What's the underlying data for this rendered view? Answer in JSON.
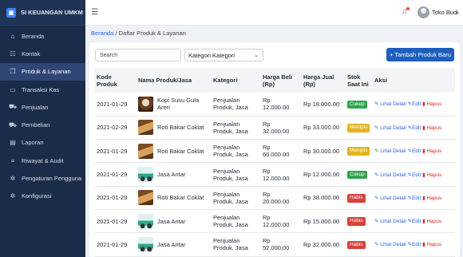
{
  "app": {
    "name": "SI KEUANGAN UMKM"
  },
  "sidebar": {
    "items": [
      {
        "label": "Beranda",
        "icon": "home-icon"
      },
      {
        "label": "Kontak",
        "icon": "users-icon"
      },
      {
        "label": "Produk & Layanan",
        "icon": "box-icon",
        "active": true
      },
      {
        "label": "Transaksi Kas",
        "icon": "cash-icon"
      },
      {
        "label": "Penjualan",
        "icon": "cart-icon"
      },
      {
        "label": "Pembelian",
        "icon": "truck-icon"
      },
      {
        "label": "Laporan",
        "icon": "chart-icon"
      },
      {
        "label": "Riwayat & Audit",
        "icon": "list-icon"
      },
      {
        "label": "Pengaturan Pengguna",
        "icon": "gear-icon"
      },
      {
        "label": "Konfigurasi",
        "icon": "gear-icon"
      }
    ]
  },
  "topbar": {
    "user": "Toko Budi"
  },
  "breadcrumb": {
    "home": "Beranda",
    "separator": "/",
    "current": "Daftar Produk & Layanan"
  },
  "toolbar": {
    "search_placeholder": "Search",
    "category_select": "Kategori Kategori",
    "add_button": "+ Tambah Produk Baru"
  },
  "table": {
    "headers": [
      "Kode Produk",
      "Nama Produk/Jasa",
      "Kategori",
      "Harga Beli (Rp)",
      "Harga Jual (Rp)",
      "Stok Saat Ini",
      "Aksi"
    ],
    "actions": {
      "detail": "Lihat Detail",
      "edit": "Edit",
      "delete": "Hapus"
    },
    "rows": [
      {
        "kode": "2021-01-29",
        "nama": "Kopi Susu Gula Aren",
        "thumb": "coffee",
        "kategori": "Penjualan Produk, Jasa",
        "beli": "Rp 12.000.00",
        "jual": "Rp 18.000.00",
        "stok": "Cukup",
        "stok_color": "#2ea44f"
      },
      {
        "kode": "2021-02-29",
        "nama": "Roti Bakar Coklat",
        "thumb": "bread",
        "kategori": "Penjualan Produk, Jasa",
        "beli": "Rp 32.000.00",
        "jual": "Rp 33.000.00",
        "stok": "Menipis",
        "stok_color": "#e6b422"
      },
      {
        "kode": "2021-01-29",
        "nama": "Roti Bakar Coklat",
        "thumb": "bread",
        "kategori": "Penjualan Produk, Jasa",
        "beli": "Rp 60.000.00",
        "jual": "Rp 30.000.00",
        "stok": "Menipis",
        "stok_color": "#e6b422"
      },
      {
        "kode": "2021-01-29",
        "nama": "Jasa Antar",
        "thumb": "scooter",
        "kategori": "Penjualan Produk, Jasa",
        "beli": "Rp 12.000.00",
        "jual": "Rp 12.000.00",
        "stok": "Cukup",
        "stok_color": "#2ea44f"
      },
      {
        "kode": "2021-01-29",
        "nama": "Roti Bakar Coklat",
        "thumb": "bread",
        "kategori": "Penjualan Produk, Jasa",
        "beli": "Rp 20.000.00",
        "jual": "Rp 38.000.00",
        "stok": "Habis",
        "stok_color": "#d9403a"
      },
      {
        "kode": "2021-01-29",
        "nama": "Jasa Antar",
        "thumb": "scooter",
        "kategori": "Penjualan Produk, Jasa",
        "beli": "Rp 12.000.00",
        "jual": "Rp 15.000.00",
        "stok": "Habis",
        "stok_color": "#d9403a"
      },
      {
        "kode": "2021-01-29",
        "nama": "Jasa Antar",
        "thumb": "scooter",
        "kategori": "Penjualan Produk, Jasa",
        "beli": "Rp 52.000.00",
        "jual": "Rp 32.000.00",
        "stok": "Habis",
        "stok_color": "#d9403a"
      }
    ]
  },
  "colors": {
    "sidebar": "#1b2c4b",
    "accent": "#1d5fbf",
    "link": "#2563eb"
  }
}
